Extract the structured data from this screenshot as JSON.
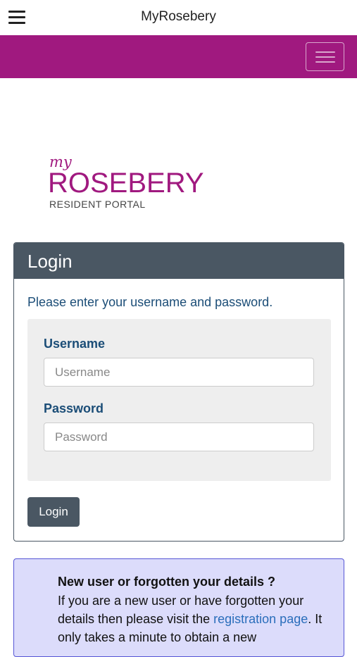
{
  "app": {
    "title": "MyRosebery"
  },
  "logo": {
    "my": "my",
    "main": "ROSEBERY",
    "sub": "RESIDENT PORTAL"
  },
  "login": {
    "heading": "Login",
    "intro": "Please enter your username and password.",
    "username_label": "Username",
    "username_placeholder": "Username",
    "username_value": "",
    "password_label": "Password",
    "password_placeholder": "Password",
    "password_value": "",
    "button_label": "Login"
  },
  "info": {
    "title": "New user or forgotten your details ?",
    "text_before_link": "If you are a new user or have forgotten your details then please visit the ",
    "link_text": "registration page",
    "text_after_link": ". It only takes a minute to obtain a new"
  },
  "colors": {
    "brand": "#a0197f",
    "panel": "#4a5763",
    "label": "#1b4d77",
    "info_bg": "#dcdcfb",
    "link": "#2a6ebb"
  }
}
